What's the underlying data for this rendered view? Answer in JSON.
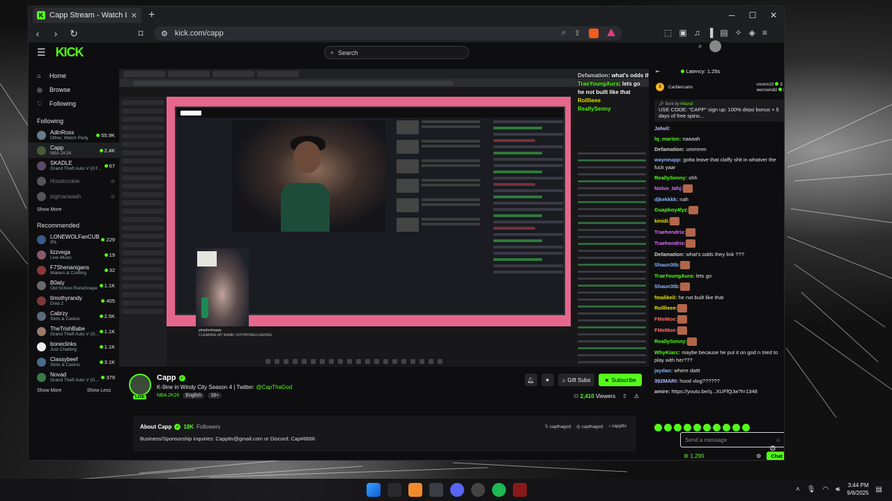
{
  "browser": {
    "tab_title": "Capp Stream - Watch Live on",
    "url": "kick.com/capp"
  },
  "kick": {
    "search_placeholder": "Search",
    "nav": [
      {
        "label": "Home",
        "icon": "home-icon"
      },
      {
        "label": "Browse",
        "icon": "browse-icon"
      },
      {
        "label": "Following",
        "icon": "heart-icon"
      }
    ],
    "following_title": "Following",
    "following": [
      {
        "name": "AdinRoss",
        "sub": "Other, Watch Party",
        "viewers": "55.9K",
        "live": true,
        "color": "#6b7a8a"
      },
      {
        "name": "Capp",
        "sub": "NBA 2K26",
        "viewers": "2.4K",
        "live": true,
        "color": "#4a5a3a",
        "active": true
      },
      {
        "name": "SKADLE",
        "sub": "Grand Theft Auto V (GT...",
        "viewers": "67",
        "live": true,
        "color": "#5a4a6a"
      },
      {
        "name": "Hoodcookie",
        "sub": "",
        "viewers": "",
        "live": false,
        "color": "#555"
      },
      {
        "name": "bigmanaaah",
        "sub": "",
        "viewers": "",
        "live": false,
        "color": "#555"
      }
    ],
    "show_more": "Show More",
    "recommended_title": "Recommended",
    "recommended": [
      {
        "name": "LONEWOLFanCUB",
        "sub": "IRL",
        "viewers": "229",
        "color": "#3a5a8a"
      },
      {
        "name": "lizzvega",
        "sub": "Live Music",
        "viewers": "19",
        "color": "#8a5a6a"
      },
      {
        "name": "F7Shenanigans",
        "sub": "Makers & Crafting",
        "viewers": "32",
        "color": "#8a3a3a"
      },
      {
        "name": "B0aty",
        "sub": "Old School RuneScape",
        "viewers": "1.1K",
        "color": "#6a6a6a"
      },
      {
        "name": "timothyrandy",
        "sub": "Dota 2",
        "viewers": "405",
        "color": "#7a3a3a"
      },
      {
        "name": "Cabrzy",
        "sub": "Slots & Casino",
        "viewers": "2.5K",
        "color": "#5a6a7a"
      },
      {
        "name": "TheTrishBabe",
        "sub": "Grand Theft Auto V (G...",
        "viewers": "1.1K",
        "color": "#9a7a6a"
      },
      {
        "name": "boneclinks",
        "sub": "Just Chatting",
        "viewers": "1.1K",
        "color": "#eee"
      },
      {
        "name": "Classybeef",
        "sub": "Slots & Casino",
        "viewers": "3.1K",
        "color": "#4a6a8a"
      },
      {
        "name": "Novad",
        "sub": "Grand Theft Auto V (G...",
        "viewers": "379",
        "color": "#3a7a4a"
      }
    ],
    "show_less": "Show Less",
    "overlay_chat": [
      {
        "user": "Defamation",
        "text": ": what's odds they link ???",
        "color": "#cfcfcf"
      },
      {
        "user": "TraeYoungAura",
        "text": ": lets go",
        "color": "#53fc18"
      },
      {
        "user": "",
        "text": "he not built like that",
        "color": "#53fc18"
      },
      {
        "user": "Rolllieee",
        "text": "",
        "color": "#e6e600"
      },
      {
        "user": "ReallySenny",
        "text": "",
        "color": "#53fc18"
      }
    ],
    "inner_name": "pimpforshaaay",
    "inner_title": "CLEARING MY NAME! #STOPFREELOADING"
  },
  "stream": {
    "streamer": "Capp",
    "live_label": "LIVE",
    "title": "K-9ine in Windy City Season 4 | Twitter: ",
    "twitter_handle": "@CapThaGod",
    "category": "NBA 2K26",
    "tags": [
      "English",
      "18+"
    ],
    "gift_label": "Gift Subs",
    "subscribe_label": "Subscribe",
    "viewers": "2,410",
    "viewers_label": "Viewers"
  },
  "about": {
    "title": "About Capp",
    "followers": "18K",
    "followers_label": "Followers",
    "body": "Business/Sponsorship inquiries: Cappttv@gmail.com or Discord: Cap#6666",
    "socials": [
      "capthagod",
      "capthagod",
      "cappttv"
    ]
  },
  "chat": {
    "latency": "Latency: 1.25s",
    "leaders": [
      "Cartiiercario",
      "vonnn10",
      "werswridd"
    ],
    "leader_counts": [
      "3",
      "3"
    ],
    "pin_by": "Sent by",
    "pin_user": "Hound",
    "pin_text": "USE CODE: \"CAPP\" sign up: 100% depo bonus + 5 days of free spins...",
    "messages": [
      {
        "user": "Jalwil:",
        "text": "",
        "color": "#b9b9ff"
      },
      {
        "user": "lq_marion:",
        "text": "naaaah",
        "color": "#53fc18"
      },
      {
        "user": "Defamation:",
        "text": "ummmm",
        "color": "#cfcfcf"
      },
      {
        "user": "wayneupp:",
        "text": "gotta leave that claffy shit in whatver the fuck yaar",
        "color": "#8ab4ff"
      },
      {
        "user": "ReallySenny:",
        "text": "ohh",
        "color": "#53fc18"
      },
      {
        "user": "Noluv_tahj:",
        "text": "",
        "color": "#e06cff",
        "emote": true
      },
      {
        "user": "djkekkkk:",
        "text": "nah",
        "color": "#8ab4ff"
      },
      {
        "user": "Guapboy4lyz:",
        "text": "",
        "color": "#53fc18",
        "emote": true
      },
      {
        "user": "kinidi:",
        "text": "",
        "color": "#e6e600",
        "emote": true
      },
      {
        "user": "Traehendrix:",
        "text": "",
        "color": "#e06cff",
        "emote": true
      },
      {
        "user": "Traehendrix:",
        "text": "",
        "color": "#e06cff",
        "emote": true
      },
      {
        "user": "Defamation:",
        "text": "what's odds they link ???",
        "color": "#cfcfcf"
      },
      {
        "user": "Shaun3tb:",
        "text": "",
        "color": "#8ab4ff",
        "emote": true
      },
      {
        "user": "TraeYoungAura:",
        "text": "lets go",
        "color": "#53fc18"
      },
      {
        "user": "Shaun3tb:",
        "text": "",
        "color": "#8ab4ff",
        "emote": true
      },
      {
        "user": "fmalikeli:",
        "text": "he not built like that",
        "color": "#e6e600"
      },
      {
        "user": "Rolllieee:",
        "text": "",
        "color": "#e6e600",
        "emote": true
      },
      {
        "user": "FMeMoe:",
        "text": "",
        "color": "#ff6b6b",
        "emote": true
      },
      {
        "user": "FMeMoe:",
        "text": "",
        "color": "#ff6b6b",
        "emote": true
      },
      {
        "user": "ReallySenny:",
        "text": "",
        "color": "#53fc18",
        "emote": true
      },
      {
        "user": "WhyKiarc:",
        "text": "maybe because he put it on god n tried to play with her???",
        "color": "#53fc18"
      },
      {
        "user": "jaydan:",
        "text": "where dattt",
        "color": "#8ab4ff"
      },
      {
        "user": "392MARI:",
        "text": "hood vlog??????",
        "color": "#b9b9ff"
      },
      {
        "user": "amire:",
        "text": "https://youtu.be/q...XUFfQJw?t=1348",
        "color": "#cfcfcf"
      }
    ],
    "input_placeholder": "Send a message",
    "points": "1,290",
    "chat_button": "Chat"
  },
  "system": {
    "time": "3:44 PM",
    "date": "9/6/2025"
  }
}
